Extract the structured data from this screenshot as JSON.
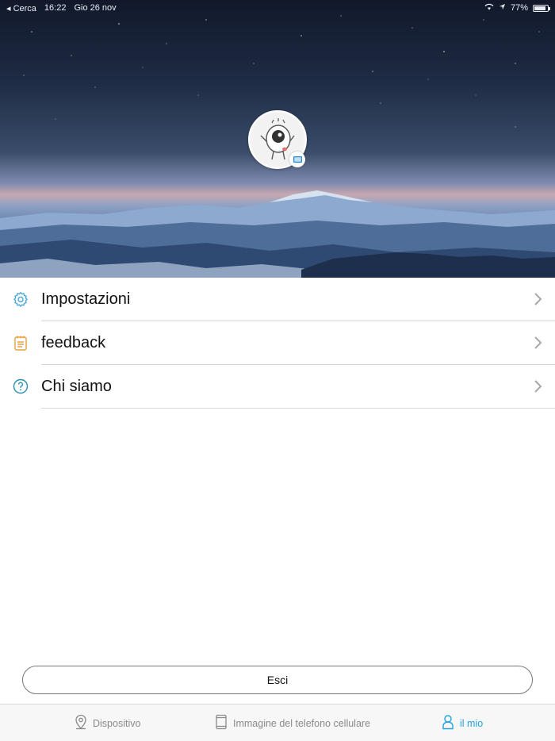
{
  "status_bar": {
    "back_label": "◂ Cerca",
    "time": "16:22",
    "date": "Gio 26 nov",
    "battery_percent": "77%",
    "battery_level": 0.77
  },
  "profile": {
    "avatar_icon": "cartoon-eye-mascot",
    "badge_icon": "device-screen-icon"
  },
  "menu": {
    "items": [
      {
        "label": "Impostazioni",
        "icon": "gear-icon",
        "icon_color": "#4aa8d8"
      },
      {
        "label": "feedback",
        "icon": "notepad-icon",
        "icon_color": "#e9a040"
      },
      {
        "label": "Chi siamo",
        "icon": "question-circle-icon",
        "icon_color": "#2a8fb0"
      }
    ]
  },
  "logout": {
    "label": "Esci"
  },
  "tabs": {
    "items": [
      {
        "label": "Dispositivo",
        "icon": "location-pin-icon",
        "active": false
      },
      {
        "label": "Immagine del telefono cellulare",
        "icon": "phone-icon",
        "active": false
      },
      {
        "label": "il mio",
        "icon": "user-icon",
        "active": true
      }
    ]
  },
  "colors": {
    "accent": "#1fa3e0",
    "inactive": "#8a8a8a",
    "separator": "#d8d8d8"
  }
}
